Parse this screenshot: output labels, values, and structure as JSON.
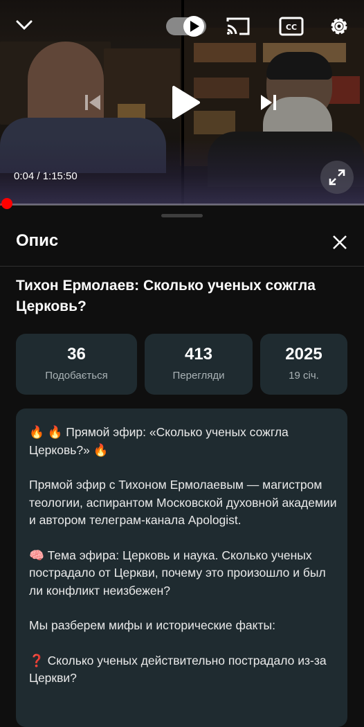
{
  "player": {
    "time_display": "0:04 / 1:15:50",
    "progress_fraction": 0.0009
  },
  "panel": {
    "title": "Опис",
    "video_title": "Тихон Ермолаев: Сколько ученых сожгла Церковь?"
  },
  "stats": [
    {
      "value": "36",
      "label": "Подобається"
    },
    {
      "value": "413",
      "label": "Перегляди"
    },
    {
      "value": "2025",
      "label": "19 січ."
    }
  ],
  "description": {
    "paragraphs": [
      "🔥 🔥 Прямой эфир: «Сколько ученых сожгла Церковь?» 🔥",
      "Прямой эфир с Тихоном Ермолаевым — магистром теологии, аспирантом Московской духовной академии и автором телеграм-канала Apologist.",
      "🧠 Тема эфира: Церковь и наука. Сколько ученых пострадало от Церкви, почему это произошло и был ли конфликт неизбежен?",
      "Мы разберем мифы и исторические факты:",
      "❓ Сколько ученых действительно пострадало из-за Церкви?"
    ]
  },
  "colors": {
    "background": "#0f0f0f",
    "card": "#1f2b30",
    "progress": "#ff0000",
    "muted_text": "#aab3b6"
  },
  "icons": [
    "chevron-down-icon",
    "autoplay-toggle-icon",
    "cast-icon",
    "captions-icon",
    "settings-icon",
    "previous-icon",
    "play-icon",
    "next-icon",
    "fullscreen-icon",
    "close-icon"
  ]
}
